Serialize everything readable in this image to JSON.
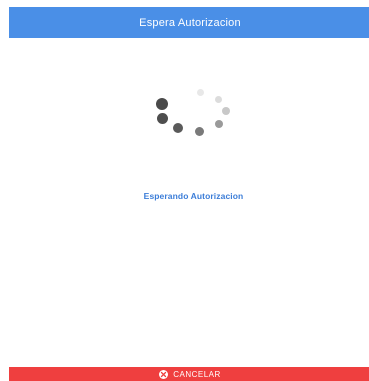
{
  "header": {
    "title": "Espera Autorizacion"
  },
  "status": {
    "message": "Esperando Autorizacion"
  },
  "spinner": {
    "icon": "loading-spinner-icon"
  },
  "cancel": {
    "label": "CANCELAR",
    "icon": "close-circle-icon"
  },
  "colors": {
    "header_bg": "#4a8fe7",
    "header_text": "#ffffff",
    "status_text": "#3b7dd8",
    "cancel_bg": "#ef3f3f",
    "cancel_text": "#ffffff",
    "spinner_dark": "#555555",
    "spinner_light": "#e6e6e6"
  }
}
